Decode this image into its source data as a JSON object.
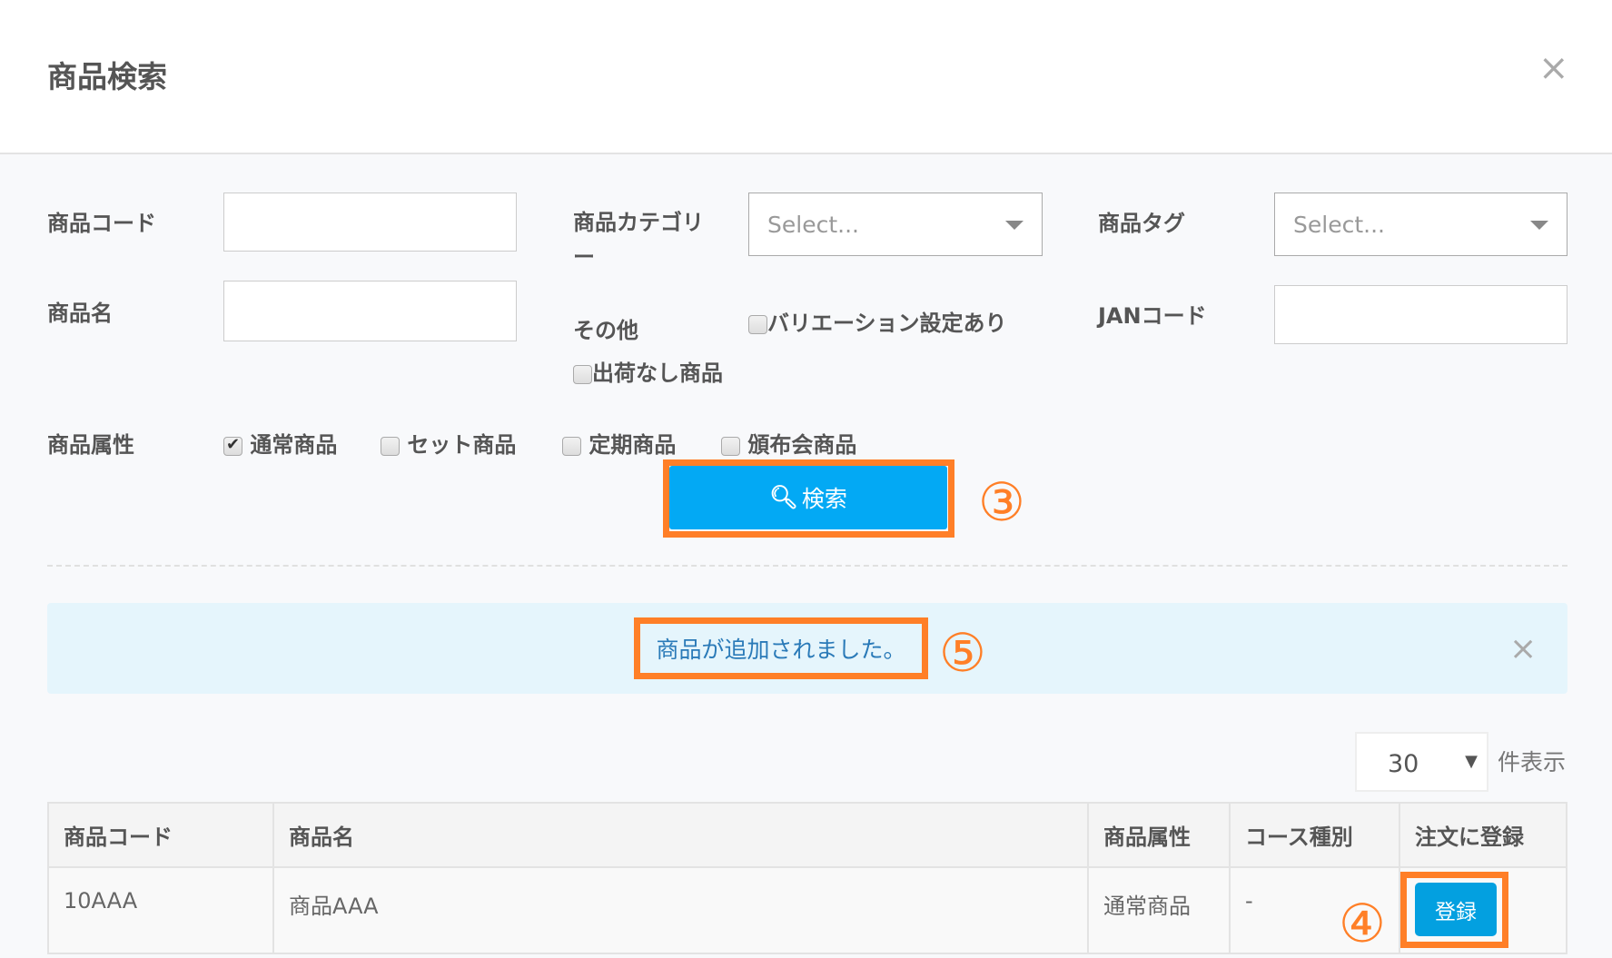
{
  "dialog": {
    "title": "商品検索",
    "close": "×"
  },
  "form": {
    "product_code_label": "商品コード",
    "product_code_value": "",
    "category_label": "商品カテゴリー",
    "category_placeholder": "Select...",
    "tag_label": "商品タグ",
    "tag_placeholder": "Select...",
    "product_name_label": "商品名",
    "product_name_value": "",
    "other_label": "その他",
    "variation_label": "バリエーション設定あり",
    "no_shipping_label": "出荷なし商品",
    "jan_label": "JANコード",
    "jan_value": "",
    "attr_label": "商品属性",
    "attrs": [
      {
        "label": "通常商品",
        "checked": true
      },
      {
        "label": "セット商品",
        "checked": false
      },
      {
        "label": "定期商品",
        "checked": false
      },
      {
        "label": "頒布会商品",
        "checked": false
      }
    ],
    "search_button": "検索"
  },
  "annotations": {
    "step3": "③",
    "step4": "④",
    "step5": "⑤"
  },
  "alert": {
    "message": "商品が追加されました。",
    "close": "×"
  },
  "pagination": {
    "per_page": "30",
    "per_page_suffix": "件表示"
  },
  "table": {
    "headers": [
      "商品コード",
      "商品名",
      "商品属性",
      "コース種別",
      "注文に登録"
    ],
    "rows": [
      {
        "code": "10AAA",
        "name": "商品AAA",
        "attr": "通常商品",
        "course": "-",
        "action": "登録"
      }
    ]
  }
}
